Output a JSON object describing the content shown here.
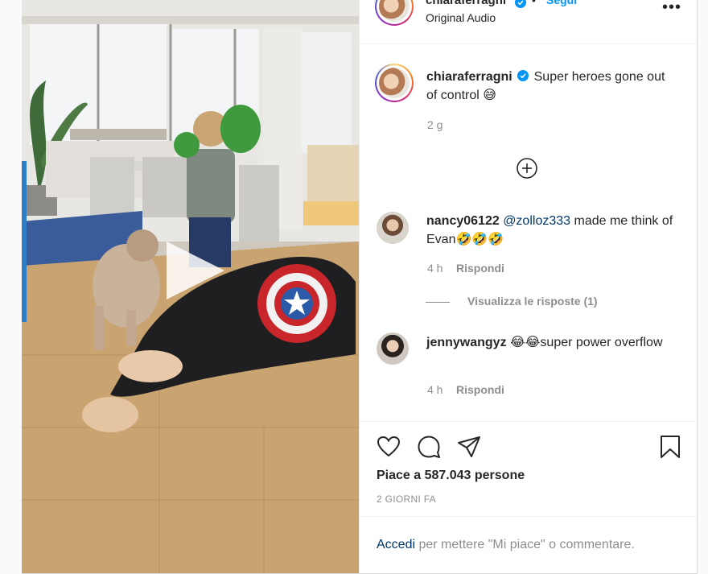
{
  "header": {
    "username": "chiaraferragni",
    "separator": "•",
    "follow_label": "Segui",
    "audio_label": "Original Audio",
    "more_label": "•••"
  },
  "caption": {
    "username": "chiaraferragni",
    "text": "Super heroes gone out of control",
    "emoji": "😅",
    "time": "2 g"
  },
  "comments": [
    {
      "username": "nancy06122",
      "mention": "@zolloz333",
      "text": "made me think of Evan",
      "emoji": "🤣🤣🤣",
      "time": "4 h",
      "reply_label": "Rispondi",
      "view_replies_label": "Visualizza le risposte (1)"
    },
    {
      "username": "jennywangyz",
      "emoji": "😂😂",
      "text": "super power overflow",
      "time": "4 h",
      "reply_label": "Rispondi"
    }
  ],
  "actions": {
    "icons": [
      "heart-icon",
      "comment-icon",
      "share-icon",
      "bookmark-icon"
    ]
  },
  "likes_label": "Piace a 587.043 persone",
  "date_label": "2 GIORNI FA",
  "footer": {
    "login_link": "Accedi",
    "login_text": "per mettere \"Mi piace\" o commentare."
  },
  "colors": {
    "link_blue": "#0095f6",
    "mention_blue": "#00376b",
    "secondary_text": "#8e8e8e",
    "verified": "#0095f6"
  }
}
